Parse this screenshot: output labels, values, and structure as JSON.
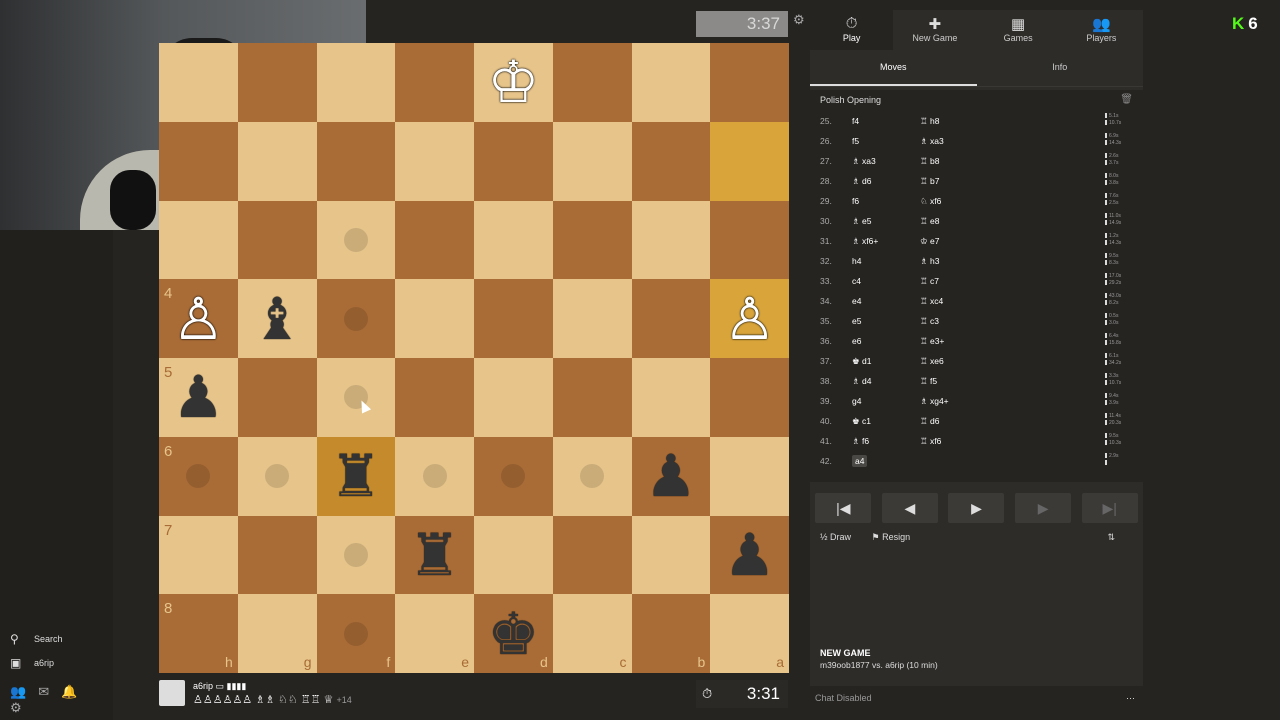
{
  "clock_top": "3:37",
  "clock_bottom": "3:31",
  "badge": {
    "logo": "K",
    "count": "6"
  },
  "nav": [
    {
      "label": "Play",
      "icon": "⏱",
      "active": true
    },
    {
      "label": "New Game",
      "icon": "✚",
      "active": false
    },
    {
      "label": "Games",
      "icon": "▦",
      "active": false
    },
    {
      "label": "Players",
      "icon": "👥",
      "active": false
    }
  ],
  "tabs": [
    "Moves",
    "Info"
  ],
  "opening": "Polish Opening",
  "moves": [
    {
      "n": "25.",
      "w": "f4",
      "b": "♖ h8",
      "t1": "5.1s",
      "t2": "10.7s"
    },
    {
      "n": "26.",
      "w": "f5",
      "b": "♗ xa3",
      "t1": "6.9s",
      "t2": "14.3s"
    },
    {
      "n": "27.",
      "w": "♗ xa3",
      "b": "♖ b8",
      "t1": "2.6s",
      "t2": "3.7s"
    },
    {
      "n": "28.",
      "w": "♗ d6",
      "b": "♖ b7",
      "t1": "8.0s",
      "t2": "3.8s"
    },
    {
      "n": "29.",
      "w": "f6",
      "b": "♘ xf6",
      "t1": "7.6s",
      "t2": "2.5s"
    },
    {
      "n": "30.",
      "w": "♗ e5",
      "b": "♖ e8",
      "t1": "11.0s",
      "t2": "14.9s"
    },
    {
      "n": "31.",
      "w": "♗ xf6+",
      "b": "♔ e7",
      "t1": "1.2s",
      "t2": "14.3s"
    },
    {
      "n": "32.",
      "w": "h4",
      "b": "♗ h3",
      "t1": "9.5s",
      "t2": "8.3s"
    },
    {
      "n": "33.",
      "w": "c4",
      "b": "♖ c7",
      "t1": "17.0s",
      "t2": "29.2s"
    },
    {
      "n": "34.",
      "w": "e4",
      "b": "♖ xc4",
      "t1": "43.0s",
      "t2": "8.2s"
    },
    {
      "n": "35.",
      "w": "e5",
      "b": "♖ c3",
      "t1": "0.5s",
      "t2": "3.0s"
    },
    {
      "n": "36.",
      "w": "e6",
      "b": "♖ e3+",
      "t1": "6.4s",
      "t2": "15.8s"
    },
    {
      "n": "37.",
      "w": "♚ d1",
      "b": "♖ xe6",
      "t1": "6.1s",
      "t2": "34.2s"
    },
    {
      "n": "38.",
      "w": "♗ d4",
      "b": "♖ f5",
      "t1": "3.3s",
      "t2": "10.7s"
    },
    {
      "n": "39.",
      "w": "g4",
      "b": "♗ xg4+",
      "t1": "9.4s",
      "t2": "3.9s"
    },
    {
      "n": "40.",
      "w": "♚ c1",
      "b": "♖ d6",
      "t1": "11.4s",
      "t2": "20.3s"
    },
    {
      "n": "41.",
      "w": "♗ f6",
      "b": "♖ xf6",
      "t1": "9.5s",
      "t2": "10.3s"
    },
    {
      "n": "42.",
      "w": "a4",
      "b": "",
      "t1": "2.9s",
      "t2": ""
    }
  ],
  "controls": [
    "|◀",
    "◀",
    "▶",
    "▶",
    "▶|"
  ],
  "actions": {
    "draw": "½ Draw",
    "resign": "⚑ Resign",
    "flip": "⇅"
  },
  "newgame": {
    "title": "NEW GAME",
    "players": "m39oob1877 vs. a6rip (10 min)"
  },
  "chat": "Chat Disabled",
  "player_bottom": {
    "name": "a6rip ▭ ▮▮▮▮",
    "material": "♙♙♙♙♙♙ ♗♗ ♘♘ ♖♖ ♕",
    "extra": "+14"
  },
  "sidebar": {
    "search": "Search",
    "user": "a6rip"
  },
  "board": {
    "ranks": [
      "",
      "",
      "",
      "4",
      "5",
      "6",
      "7",
      "8"
    ],
    "files": [
      "h",
      "g",
      "f",
      "e",
      "d",
      "c",
      "b",
      "a"
    ],
    "pieces": {
      "0-4": {
        "g": "♔",
        "c": "w"
      },
      "3-0": {
        "g": "♙",
        "c": "w"
      },
      "3-1": {
        "g": "♝",
        "c": "b"
      },
      "3-7": {
        "g": "♙",
        "c": "w"
      },
      "4-0": {
        "g": "♟",
        "c": "b"
      },
      "5-2": {
        "g": "♜",
        "c": "b"
      },
      "5-6": {
        "g": "♟",
        "c": "b"
      },
      "6-3": {
        "g": "♜",
        "c": "b"
      },
      "6-7": {
        "g": "♟",
        "c": "b"
      },
      "7-4": {
        "g": "♚",
        "c": "b"
      }
    },
    "dots": [
      "2-2",
      "3-2",
      "4-2",
      "5-0",
      "5-1",
      "5-3",
      "5-4",
      "5-5",
      "6-2",
      "7-2"
    ],
    "highlight": [
      "1-7",
      "3-7",
      "5-2"
    ]
  }
}
